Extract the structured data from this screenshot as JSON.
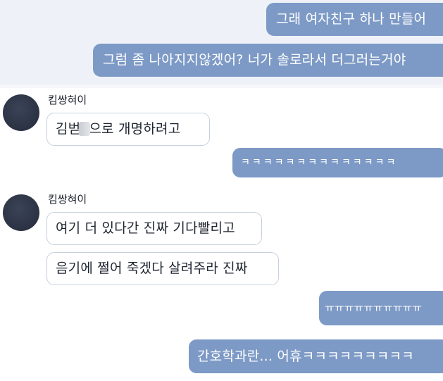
{
  "messages_top": [
    {
      "text": "그래 여자친구 하나 만들어"
    },
    {
      "text": "그럼 좀 나아지지않겠어? 너가 솔로라서 더그러는거야"
    }
  ],
  "group1": {
    "sender": "킴쌍혀이",
    "msg_part_a": "김벋",
    "msg_part_b": "으로 개명하려고"
  },
  "reply1": {
    "text": "ㅋㅋㅋㅋㅋㅋㅋㅋㅋㅋㅋㅋㅋㅋ"
  },
  "group2": {
    "sender": "킴쌍혀이",
    "messages": [
      {
        "text": "여기 더 있다간 진짜 기다빨리고"
      },
      {
        "text": "음기에 쩔어 죽겠다 살려주라 진짜"
      }
    ]
  },
  "reply2": {
    "text": "ㅠㅠㅠㅠㅠㅠㅠㅠㅠㅠ"
  },
  "reply3": {
    "text": "간호학과란... 어휴ㅋㅋㅋㅋㅋㅋㅋㅋㅋ"
  }
}
